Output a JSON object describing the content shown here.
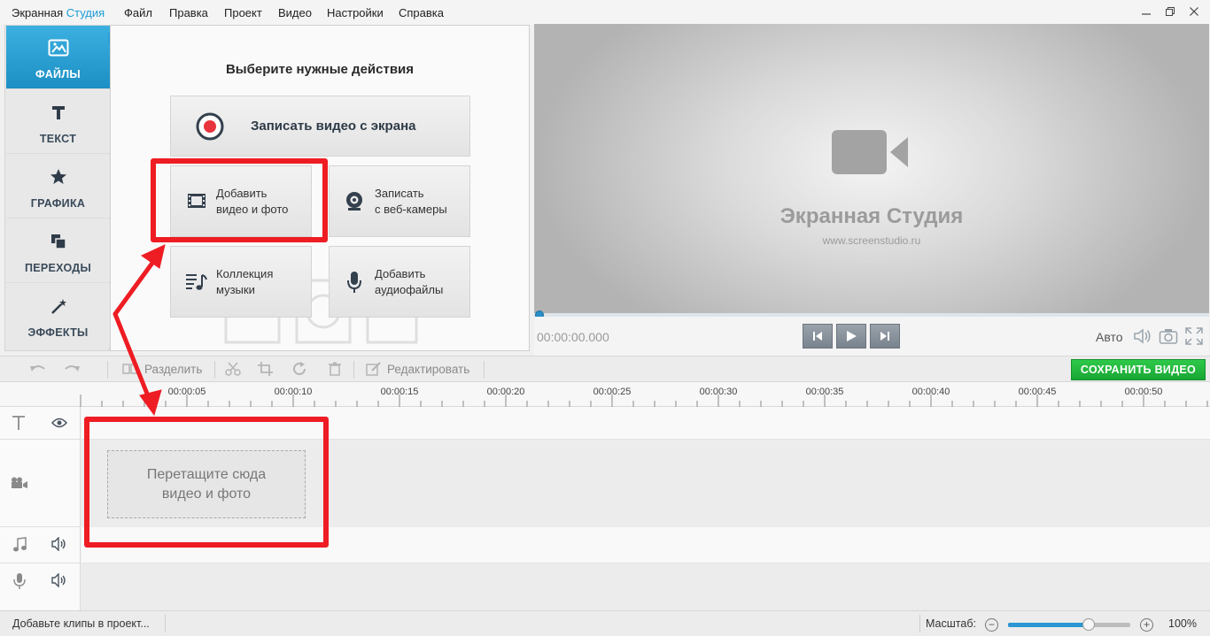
{
  "window": {
    "title_part1": "Экранная",
    "title_part2": "Студия",
    "menu": [
      "Файл",
      "Правка",
      "Проект",
      "Видео",
      "Настройки",
      "Справка"
    ]
  },
  "sidebar": {
    "items": [
      {
        "label": "ФАЙЛЫ",
        "icon": "image-icon",
        "active": true
      },
      {
        "label": "ТЕКСТ",
        "icon": "text-icon"
      },
      {
        "label": "ГРАФИКА",
        "icon": "star-icon"
      },
      {
        "label": "ПЕРЕХОДЫ",
        "icon": "transitions-icon"
      },
      {
        "label": "ЭФФЕКТЫ",
        "icon": "magic-wand-icon"
      }
    ]
  },
  "action_panel": {
    "title": "Выберите нужные действия",
    "record_screen": "Записать видео с экрана",
    "add_media_line1": "Добавить",
    "add_media_line2": "видео и фото",
    "webcam_line1": "Записать",
    "webcam_line2": "с веб-камеры",
    "music_line1": "Коллекция",
    "music_line2": "музыки",
    "audio_line1": "Добавить",
    "audio_line2": "аудиофайлы"
  },
  "preview": {
    "brand": "Экранная Студия",
    "url": "www.screenstudio.ru",
    "timecode": "00:00:00.000",
    "quality": "Авто"
  },
  "toolbar": {
    "split_label": "Разделить",
    "edit_label": "Редактировать",
    "save_label": "СОХРАНИТЬ ВИДЕО"
  },
  "timeline": {
    "ticks": [
      "00:00:05",
      "00:00:10",
      "00:00:15",
      "00:00:20",
      "00:00:25",
      "00:00:30",
      "00:00:35",
      "00:00:40",
      "00:00:45",
      "00:00:50"
    ],
    "drop_line1": "Перетащите сюда",
    "drop_line2": "видео и фото"
  },
  "statusbar": {
    "status": "Добавьте клипы в проект...",
    "zoom_label": "Масштаб:",
    "zoom_value": "100%",
    "zoom_level": 0.66
  },
  "colors": {
    "accent": "#1a9bd7",
    "save_green": "#19a633",
    "annotation_red": "#ee1d23",
    "record_red": "#e8343c"
  }
}
